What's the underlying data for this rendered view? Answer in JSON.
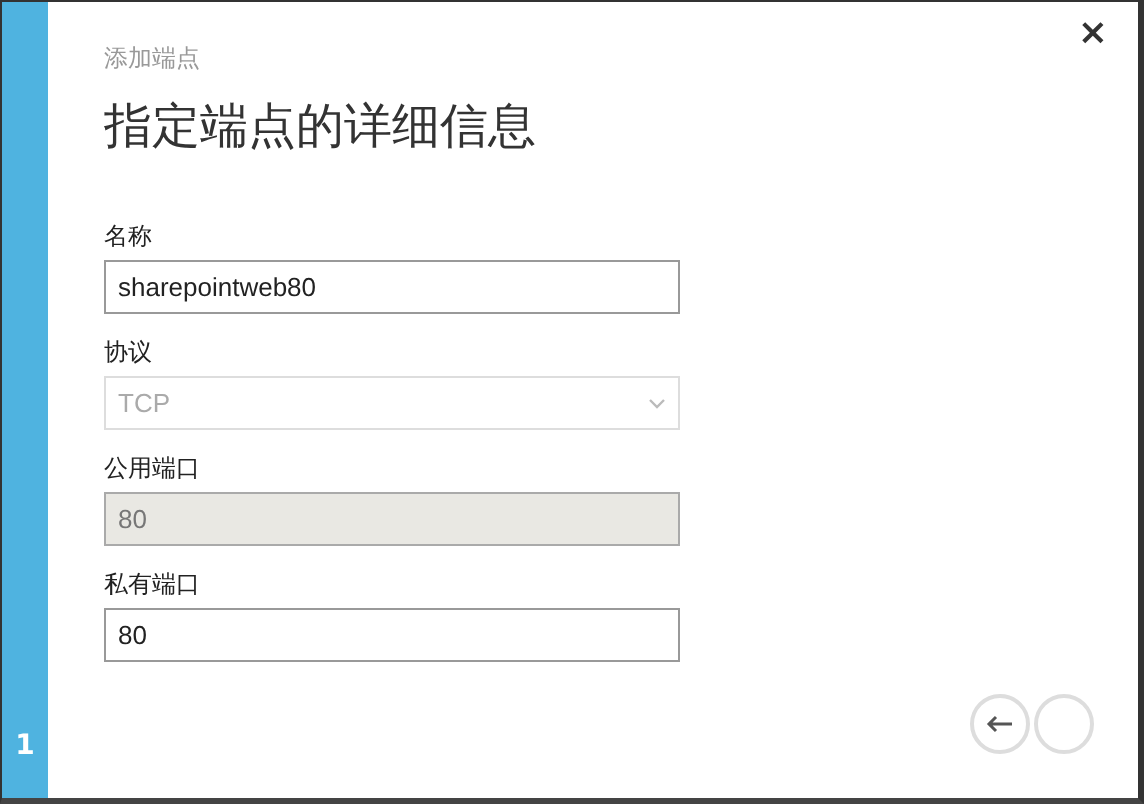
{
  "wizard": {
    "step": "1",
    "subtitle": "添加端点",
    "title": "指定端点的详细信息",
    "close": "×"
  },
  "fields": [
    {
      "label": "名称",
      "kind": "text",
      "value": "sharepointweb80",
      "disabled": false
    },
    {
      "label": "协议",
      "kind": "select",
      "value": "TCP",
      "disabled": true
    },
    {
      "label": "公用端口",
      "kind": "text",
      "value": "80",
      "disabled": true
    },
    {
      "label": "私有端口",
      "kind": "text",
      "value": "80",
      "disabled": false
    }
  ]
}
